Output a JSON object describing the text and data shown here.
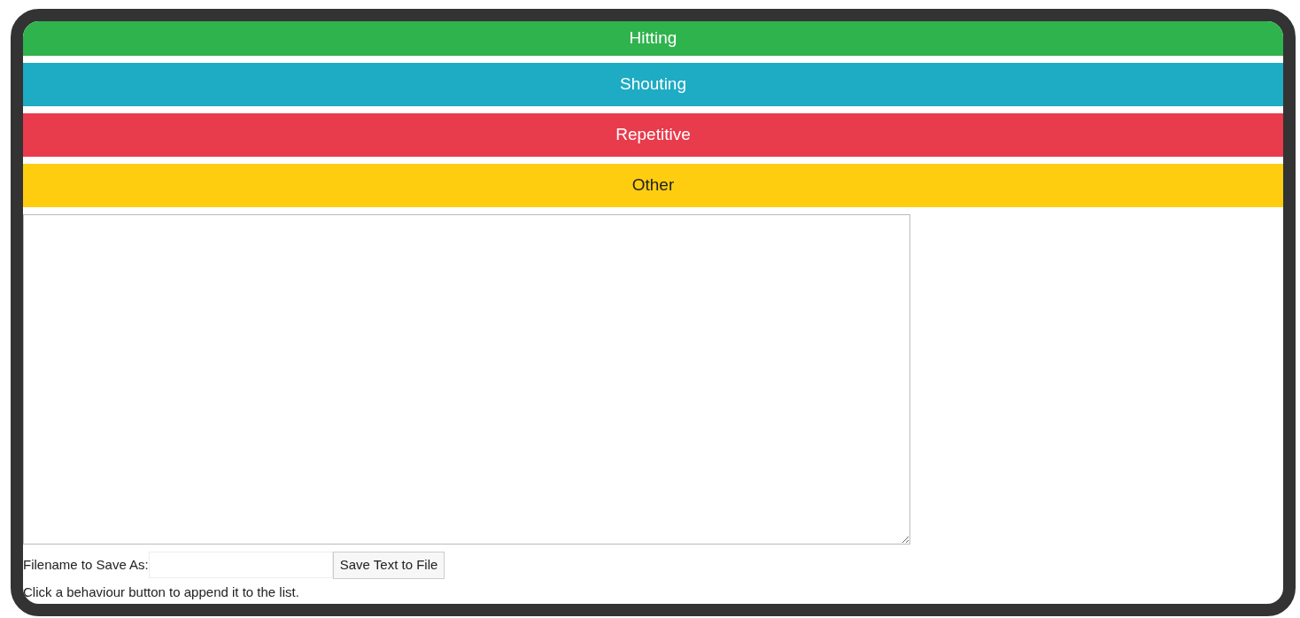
{
  "behaviour_buttons": [
    {
      "label": "Hitting",
      "color": "#2fb34d"
    },
    {
      "label": "Shouting",
      "color": "#1eabc4"
    },
    {
      "label": "Repetitive",
      "color": "#e83b4c"
    },
    {
      "label": "Other",
      "color": "#fecd0f"
    }
  ],
  "filename_label": "Filename to Save As:",
  "save_button": "Save Text to File",
  "hint": "Click a behaviour button to append it to the list."
}
